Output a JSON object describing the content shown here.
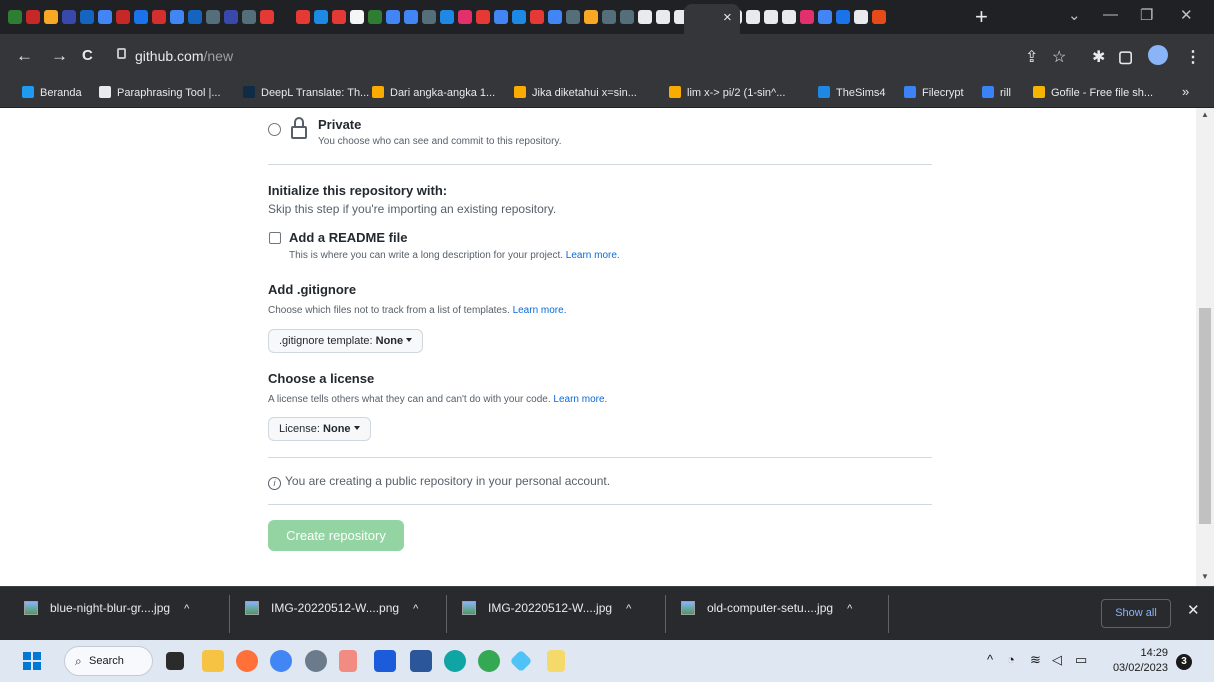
{
  "browser": {
    "tab_close": "×",
    "new_tab": "+",
    "window_controls": {
      "down": "⌄",
      "minimize": "—",
      "restore": "❐",
      "close": "✕"
    },
    "url_host": "github.com",
    "url_path": "/new",
    "nav": {
      "back": "←",
      "forward": "→",
      "reload": "C"
    },
    "toolbar_icons": {
      "share": "⇪",
      "star": "☆",
      "extensions": "✱",
      "sidepanel": "▢",
      "menu": "⋮"
    }
  },
  "bookmarks": [
    {
      "label": "Beranda",
      "color": "#1d9bf0"
    },
    {
      "label": "Paraphrasing Tool |...",
      "color": "#e8eaed"
    },
    {
      "label": "DeepL Translate: Th...",
      "color": "#0f2b46"
    },
    {
      "label": "Dari angka-angka 1...",
      "color": "#f9ab00"
    },
    {
      "label": "Jika diketahui x=sin...",
      "color": "#f9ab00"
    },
    {
      "label": "lim x-> pi/2 (1-sin^...",
      "color": "#f9ab00"
    },
    {
      "label": "TheSims4",
      "color": "#1e88e5"
    },
    {
      "label": "Filecrypt",
      "color": "#3b82f6"
    },
    {
      "label": "rill",
      "color": "#3b82f6"
    },
    {
      "label": "Gofile - Free file sh...",
      "color": "#f5b400"
    }
  ],
  "bookmarks_more": "»",
  "form": {
    "private_title": "Private",
    "private_desc": "You choose who can see and commit to this repository.",
    "init_heading": "Initialize this repository with:",
    "init_sub": "Skip this step if you're importing an existing repository.",
    "readme_label": "Add a README file",
    "readme_desc": "This is where you can write a long description for your project.",
    "learn_more": "Learn more.",
    "gitignore_heading": "Add .gitignore",
    "gitignore_desc": "Choose which files not to track from a list of templates.",
    "gitignore_btn_prefix": ".gitignore template:",
    "gitignore_btn_value": "None",
    "license_heading": "Choose a license",
    "license_desc": "A license tells others what they can and can't do with your code.",
    "license_btn_prefix": "License:",
    "license_btn_value": "None",
    "info_text": "You are creating a public repository in your personal account.",
    "create_btn": "Create repository"
  },
  "downloads": [
    {
      "name": "blue-night-blur-gr....jpg"
    },
    {
      "name": "IMG-20220512-W....png"
    },
    {
      "name": "IMG-20220512-W....jpg"
    },
    {
      "name": "old-computer-setu....jpg"
    }
  ],
  "downloads_show_all": "Show all",
  "downloads_close": "✕",
  "taskbar": {
    "search_label": "Search",
    "time": "14:29",
    "date": "03/02/2023",
    "notifications": "3"
  }
}
